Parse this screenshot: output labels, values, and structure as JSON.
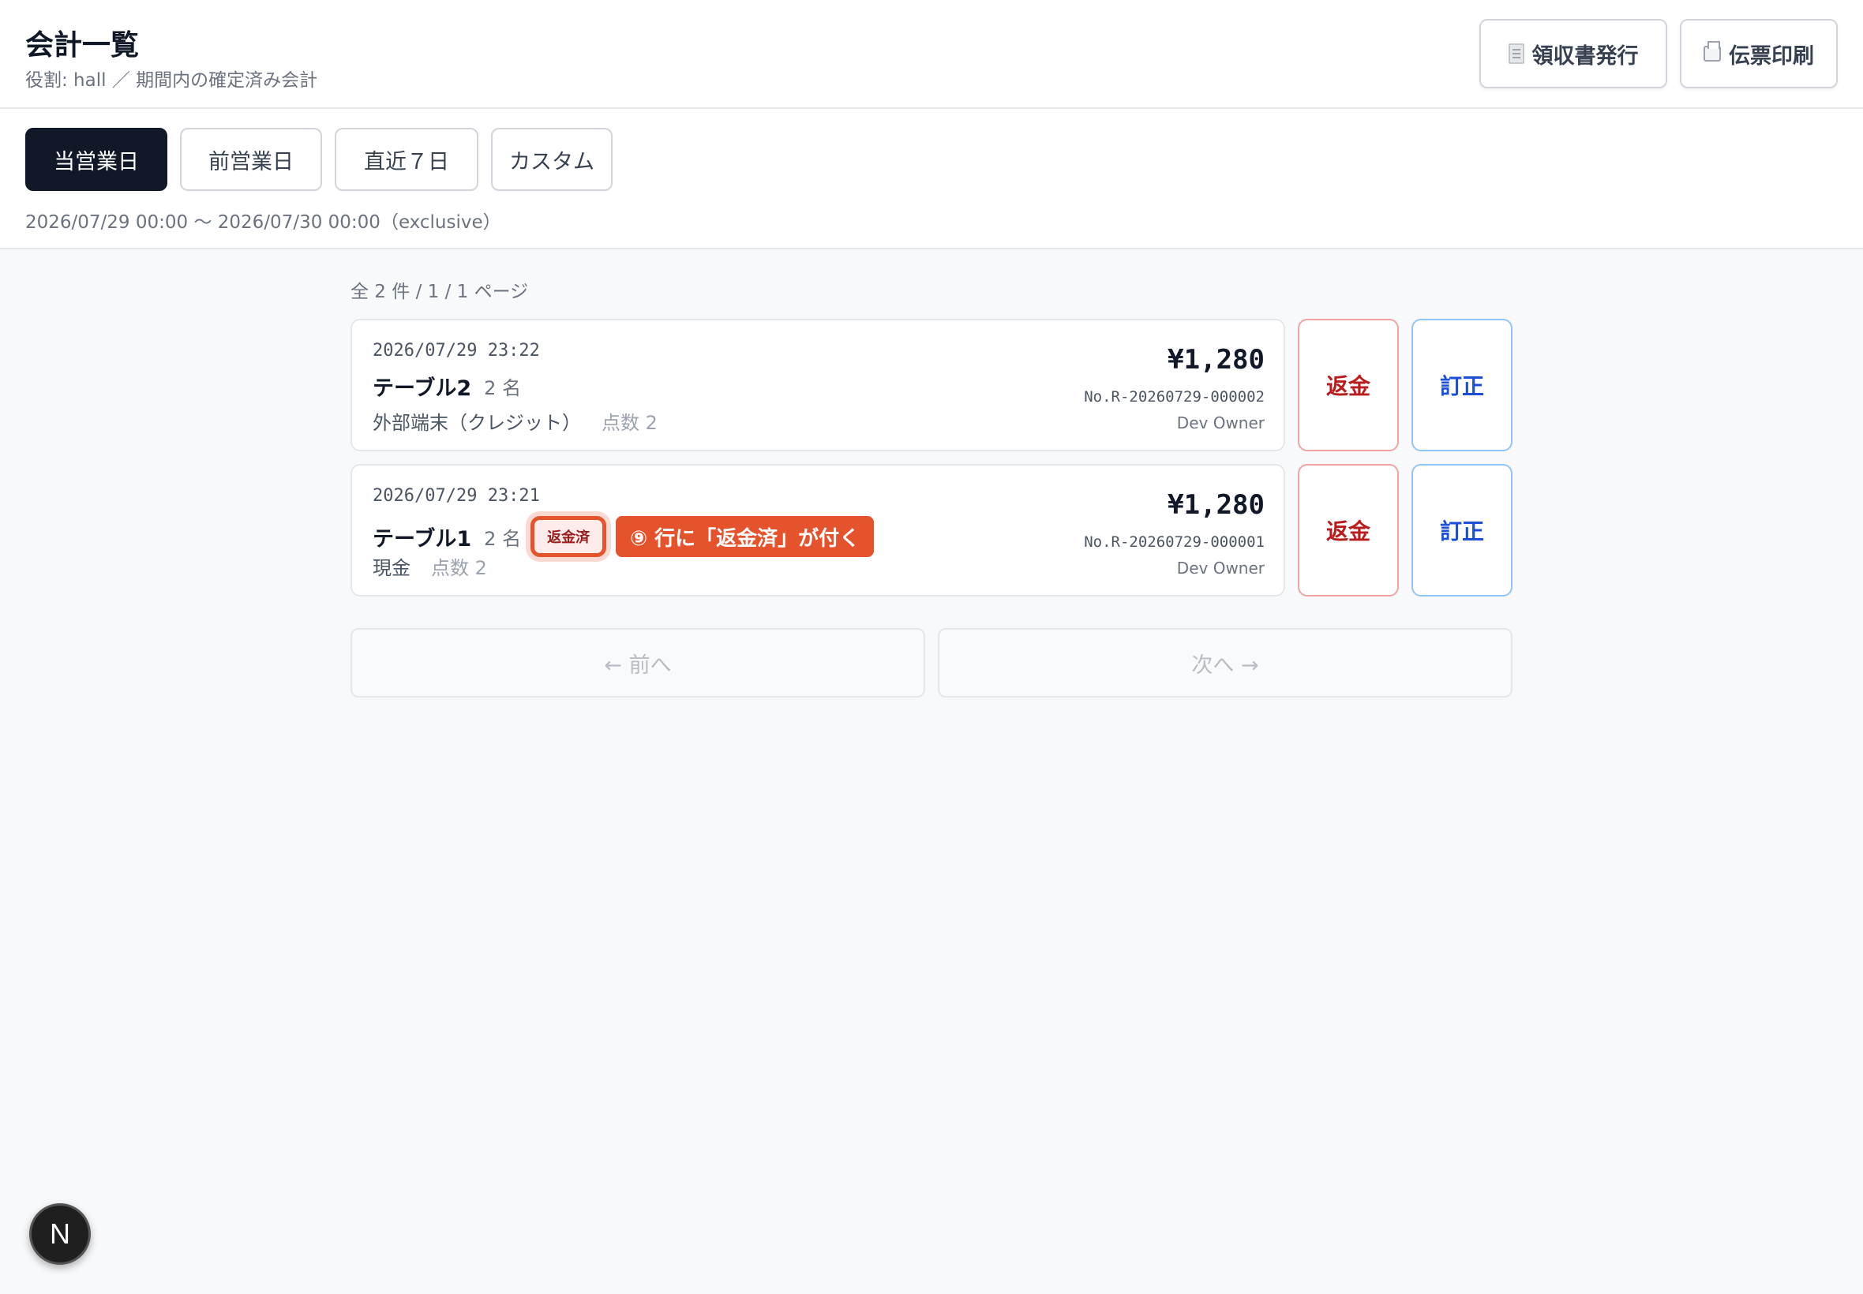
{
  "header": {
    "title": "会計一覧",
    "subtitle": "役割: hall ／ 期間内の確定済み会計",
    "receipt_button": "領収書発行",
    "print_button": "伝票印刷"
  },
  "filters": {
    "periods": [
      "当営業日",
      "前営業日",
      "直近７日",
      "カスタム"
    ],
    "active_period": "当営業日",
    "range_text": "2026/07/29 00:00 〜 2026/07/30 00:00（exclusive）"
  },
  "list": {
    "count_text": "全 2 件 / 1 / 1 ページ",
    "rows": [
      {
        "timestamp": "2026/07/29 23:22",
        "table": "テーブル2",
        "guests": "2 名",
        "payment": "外部端末（クレジット）",
        "points": "点数 2",
        "amount": "¥1,280",
        "receipt_no": "No.R-20260729-000002",
        "staff": "Dev Owner",
        "refunded": false
      },
      {
        "timestamp": "2026/07/29 23:21",
        "table": "テーブル1",
        "guests": "2 名",
        "badge": "返金済",
        "callout": "⑨ 行に「返金済」が付く",
        "payment": "現金",
        "points": "点数 2",
        "amount": "¥1,280",
        "receipt_no": "No.R-20260729-000001",
        "staff": "Dev Owner",
        "refunded": true
      }
    ],
    "refund_label": "返金",
    "correct_label": "訂正"
  },
  "pagination": {
    "prev": "← 前へ",
    "next": "次へ →"
  },
  "dev_indicator": "N",
  "colors": {
    "accent_dark": "#111827",
    "refund_red": "#b91c1c",
    "correct_blue": "#1d4ed8",
    "callout_orange": "#e5532d"
  }
}
